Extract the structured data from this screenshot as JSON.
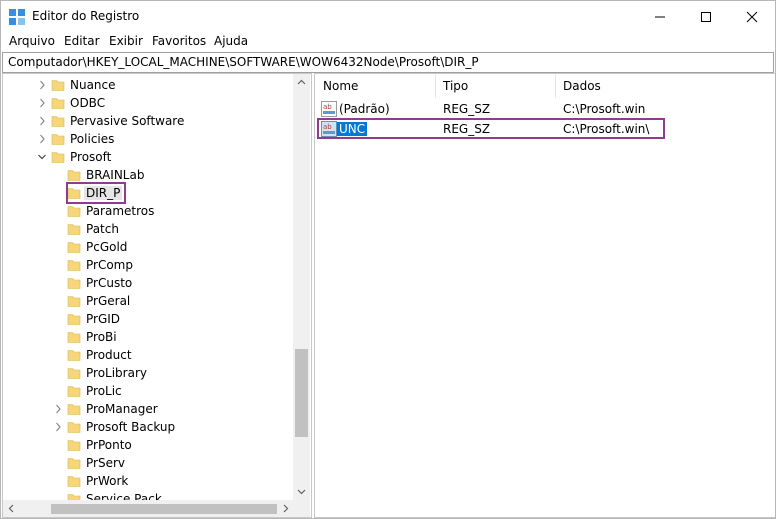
{
  "window": {
    "title": "Editor do Registro",
    "controls": {
      "minimize": "—",
      "maximize": "☐",
      "close": "✕"
    }
  },
  "menu": [
    "Arquivo",
    "Editar",
    "Exibir",
    "Favoritos",
    "Ajuda"
  ],
  "address": "Computador\\HKEY_LOCAL_MACHINE\\SOFTWARE\\WOW6432Node\\Prosoft\\DIR_P",
  "tree": {
    "items": [
      {
        "label": "Nuance",
        "level": 1,
        "expander": "collapsed"
      },
      {
        "label": "ODBC",
        "level": 1,
        "expander": "collapsed"
      },
      {
        "label": "Pervasive Software",
        "level": 1,
        "expander": "collapsed"
      },
      {
        "label": "Policies",
        "level": 1,
        "expander": "collapsed"
      },
      {
        "label": "Prosoft",
        "level": 1,
        "expander": "expanded"
      },
      {
        "label": "BRAINLab",
        "level": 2,
        "expander": "none"
      },
      {
        "label": "DIR_P",
        "level": 2,
        "expander": "none",
        "selected": true
      },
      {
        "label": "Parametros",
        "level": 2,
        "expander": "none"
      },
      {
        "label": "Patch",
        "level": 2,
        "expander": "none"
      },
      {
        "label": "PcGold",
        "level": 2,
        "expander": "none"
      },
      {
        "label": "PrComp",
        "level": 2,
        "expander": "none"
      },
      {
        "label": "PrCusto",
        "level": 2,
        "expander": "none"
      },
      {
        "label": "PrGeral",
        "level": 2,
        "expander": "none"
      },
      {
        "label": "PrGID",
        "level": 2,
        "expander": "none"
      },
      {
        "label": "ProBi",
        "level": 2,
        "expander": "none"
      },
      {
        "label": "Product",
        "level": 2,
        "expander": "none"
      },
      {
        "label": "ProLibrary",
        "level": 2,
        "expander": "none"
      },
      {
        "label": "ProLic",
        "level": 2,
        "expander": "none"
      },
      {
        "label": "ProManager",
        "level": 2,
        "expander": "collapsed"
      },
      {
        "label": "Prosoft Backup",
        "level": 2,
        "expander": "collapsed"
      },
      {
        "label": "PrPonto",
        "level": 2,
        "expander": "none"
      },
      {
        "label": "PrServ",
        "level": 2,
        "expander": "none"
      },
      {
        "label": "PrWork",
        "level": 2,
        "expander": "none"
      },
      {
        "label": "Service Pack",
        "level": 2,
        "expander": "none"
      }
    ]
  },
  "values": {
    "columns": [
      "Nome",
      "Tipo",
      "Dados"
    ],
    "rows": [
      {
        "name": "(Padrão)",
        "type": "REG_SZ",
        "data": "C:\\Prosoft.win",
        "icon": "string-value-icon"
      },
      {
        "name": "UNC",
        "type": "REG_SZ",
        "data": "C:\\Prosoft.win\\",
        "icon": "string-value-icon",
        "selected": true
      }
    ]
  },
  "colors": {
    "highlight": "#8e3c8e",
    "selection": "#0078d7",
    "folder": "#f5d77a"
  }
}
